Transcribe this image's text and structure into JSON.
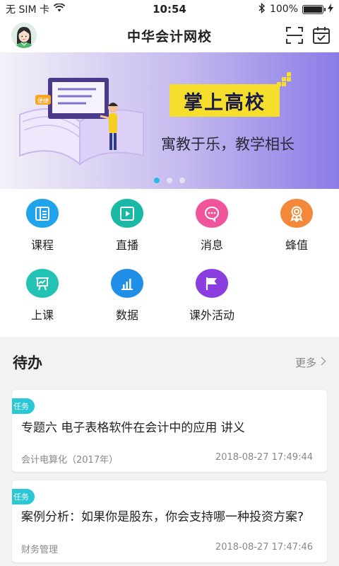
{
  "status_bar": {
    "carrier": "无 SIM 卡",
    "time": "10:54",
    "battery_text": "100%"
  },
  "header": {
    "title": "中华会计网校",
    "icons": [
      "avatar",
      "scan-icon",
      "calendar-check-icon"
    ]
  },
  "banner": {
    "tag": "掌上高校",
    "slogan": "寓教于乐，教学相长",
    "book_tag": "便捷",
    "dots": 3,
    "active_dot": 0
  },
  "menu": {
    "items": [
      {
        "label": "课程",
        "icon": "list-icon",
        "color": "#1fa3ea"
      },
      {
        "label": "直播",
        "icon": "play-icon",
        "color": "#19b9a5"
      },
      {
        "label": "消息",
        "icon": "chat-bubble-icon",
        "color": "#f0559b"
      },
      {
        "label": "蜂值",
        "icon": "badge-icon",
        "color": "#f4883a"
      },
      {
        "label": "上课",
        "icon": "presentation-icon",
        "color": "#22c2b4"
      },
      {
        "label": "数据",
        "icon": "bar-chart-icon",
        "color": "#1f8fe8"
      },
      {
        "label": "课外活动",
        "icon": "flag-icon",
        "color": "#8a3ee0"
      }
    ]
  },
  "todo": {
    "title": "待办",
    "more_label": "更多",
    "tasks": [
      {
        "badge": "任务",
        "title": "专题六 电子表格软件在会计中的应用 讲义",
        "course": "会计电算化（2017年）",
        "time": "2018-08-27 17:49:44"
      },
      {
        "badge": "任务",
        "title": "案例分析：如果你是股东，你会支持哪一种投资方案?",
        "course": "财务管理",
        "time": "2018-08-27 17:47:46"
      }
    ]
  },
  "colors": {
    "accent_blue": "#2ab8e6",
    "badge_teal": "#2ac7d6",
    "tag_yellow": "#f5df2c"
  }
}
